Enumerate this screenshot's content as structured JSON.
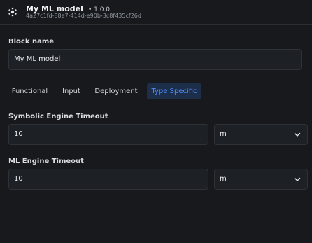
{
  "header": {
    "title": "My ML model",
    "version": "• 1.0.0",
    "block_id": "4a27c1fd-88e7-414d-e90b-3c8f435cf26d"
  },
  "block_name": {
    "label": "Block name",
    "value": "My ML model"
  },
  "tabs": [
    {
      "label": "Functional",
      "active": false
    },
    {
      "label": "Input",
      "active": false
    },
    {
      "label": "Deployment",
      "active": false
    },
    {
      "label": "Type Specific",
      "active": true
    }
  ],
  "symbolic_timeout": {
    "label": "Symbolic Engine Timeout",
    "value": "10",
    "unit": "m"
  },
  "ml_timeout": {
    "label": "ML Engine Timeout",
    "value": "10",
    "unit": "m"
  },
  "colors": {
    "background": "#17191d",
    "accent": "#4d8dff",
    "active_tab_bg": "#1d2e4b"
  },
  "icons": {
    "block": "gear-block-icon",
    "select": "chevron-down-icon"
  }
}
